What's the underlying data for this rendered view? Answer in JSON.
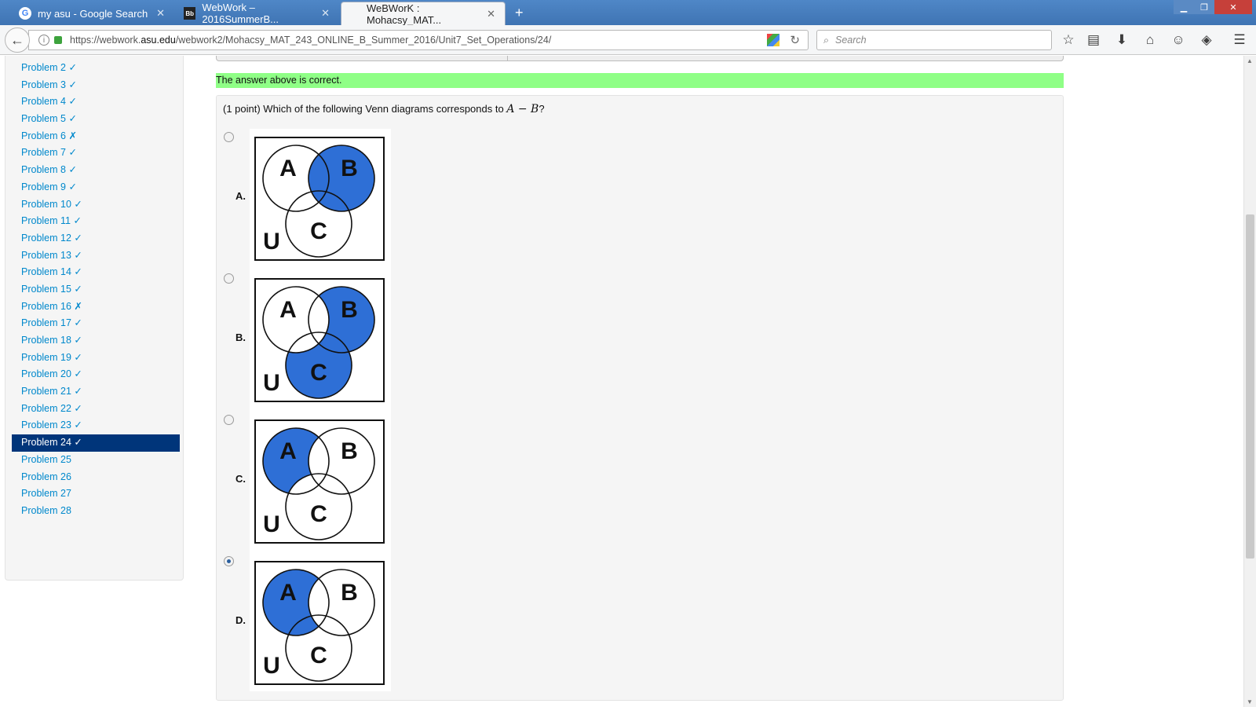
{
  "browser": {
    "tabs": [
      {
        "title": "my asu - Google Search",
        "favicon": "google-icon",
        "active": false
      },
      {
        "title": "WebWork – 2016SummerB...",
        "favicon": "blackboard-icon",
        "active": false
      },
      {
        "title": "WeBWorK : Mohacsy_MAT...",
        "favicon": "",
        "active": true
      }
    ],
    "url_prefix": "https://webwork.",
    "url_domain": "asu.edu",
    "url_path": "/webwork2/Mohacsy_MAT_243_ONLINE_B_Summer_2016/Unit7_Set_Operations/24/",
    "search_placeholder": "Search"
  },
  "sidebar": {
    "problems": [
      {
        "label": "Problem 2 ✓"
      },
      {
        "label": "Problem 3 ✓"
      },
      {
        "label": "Problem 4 ✓"
      },
      {
        "label": "Problem 5 ✓"
      },
      {
        "label": "Problem 6 ✗"
      },
      {
        "label": "Problem 7 ✓"
      },
      {
        "label": "Problem 8 ✓"
      },
      {
        "label": "Problem 9 ✓"
      },
      {
        "label": "Problem 10 ✓"
      },
      {
        "label": "Problem 11 ✓"
      },
      {
        "label": "Problem 12 ✓"
      },
      {
        "label": "Problem 13 ✓"
      },
      {
        "label": "Problem 14 ✓"
      },
      {
        "label": "Problem 15 ✓"
      },
      {
        "label": "Problem 16 ✗"
      },
      {
        "label": "Problem 17 ✓"
      },
      {
        "label": "Problem 18 ✓"
      },
      {
        "label": "Problem 19 ✓"
      },
      {
        "label": "Problem 20 ✓"
      },
      {
        "label": "Problem 21 ✓"
      },
      {
        "label": "Problem 22 ✓"
      },
      {
        "label": "Problem 23 ✓"
      },
      {
        "label": "Problem 24 ✓",
        "active": true
      },
      {
        "label": "Problem 25"
      },
      {
        "label": "Problem 26"
      },
      {
        "label": "Problem 27"
      },
      {
        "label": "Problem 28"
      }
    ]
  },
  "feedback": {
    "message": "The answer above is correct.",
    "color": "#8fff86"
  },
  "problem": {
    "prompt_prefix": "(1 point) Which of the following Venn diagrams corresponds to ",
    "prompt_math": "A − B",
    "prompt_suffix": "?",
    "options": [
      {
        "label": "A.",
        "shaded": "B",
        "selected": false
      },
      {
        "label": "B.",
        "shaded": "B ∪ C minus A",
        "selected": false
      },
      {
        "label": "C.",
        "shaded": "A minus (B ∪ C)",
        "selected": false
      },
      {
        "label": "D.",
        "shaded": "A minus B",
        "selected": true
      }
    ],
    "venn_letters": {
      "a": "A",
      "b": "B",
      "c": "C",
      "u": "U"
    },
    "fill_color": "#2e6fd6"
  }
}
